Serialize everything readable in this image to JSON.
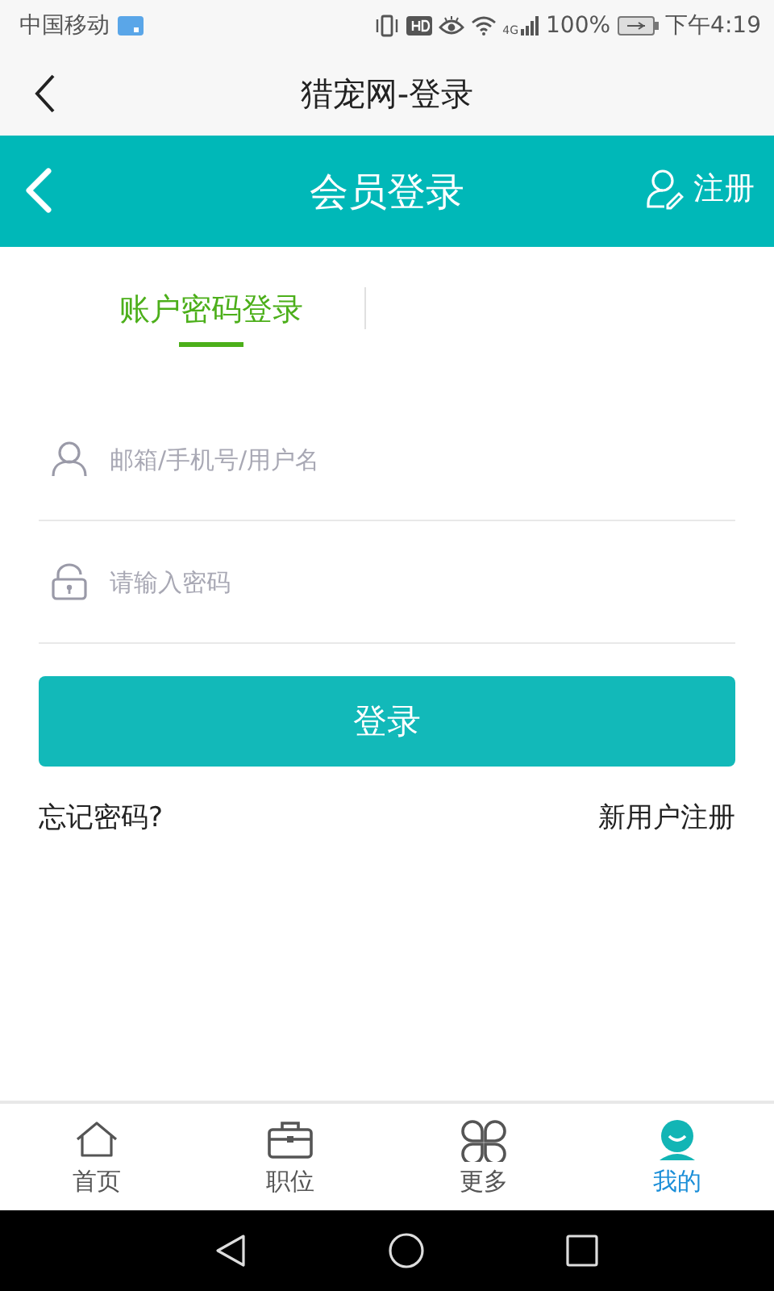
{
  "status_bar": {
    "carrier": "中国移动",
    "network": "4G",
    "battery": "100%",
    "time": "下午4:19"
  },
  "app_bar": {
    "title": "猎宠网-登录"
  },
  "header": {
    "title": "会员登录",
    "action": "注册"
  },
  "login_tabs": [
    {
      "label": "账户密码登录",
      "selected": true
    }
  ],
  "fields": [
    {
      "kind": "user",
      "placeholder": "邮箱/手机号/用户名"
    },
    {
      "kind": "password",
      "placeholder": "请输入密码"
    }
  ],
  "submit": "登录",
  "links": {
    "forgot": "忘记密码?",
    "register": "新用户注册"
  },
  "bottom_nav": [
    {
      "kind": "home",
      "label": "首页",
      "selected": false
    },
    {
      "kind": "jobs",
      "label": "职位",
      "selected": false
    },
    {
      "kind": "more",
      "label": "更多",
      "selected": false
    },
    {
      "kind": "me",
      "label": "我的",
      "selected": true
    }
  ]
}
